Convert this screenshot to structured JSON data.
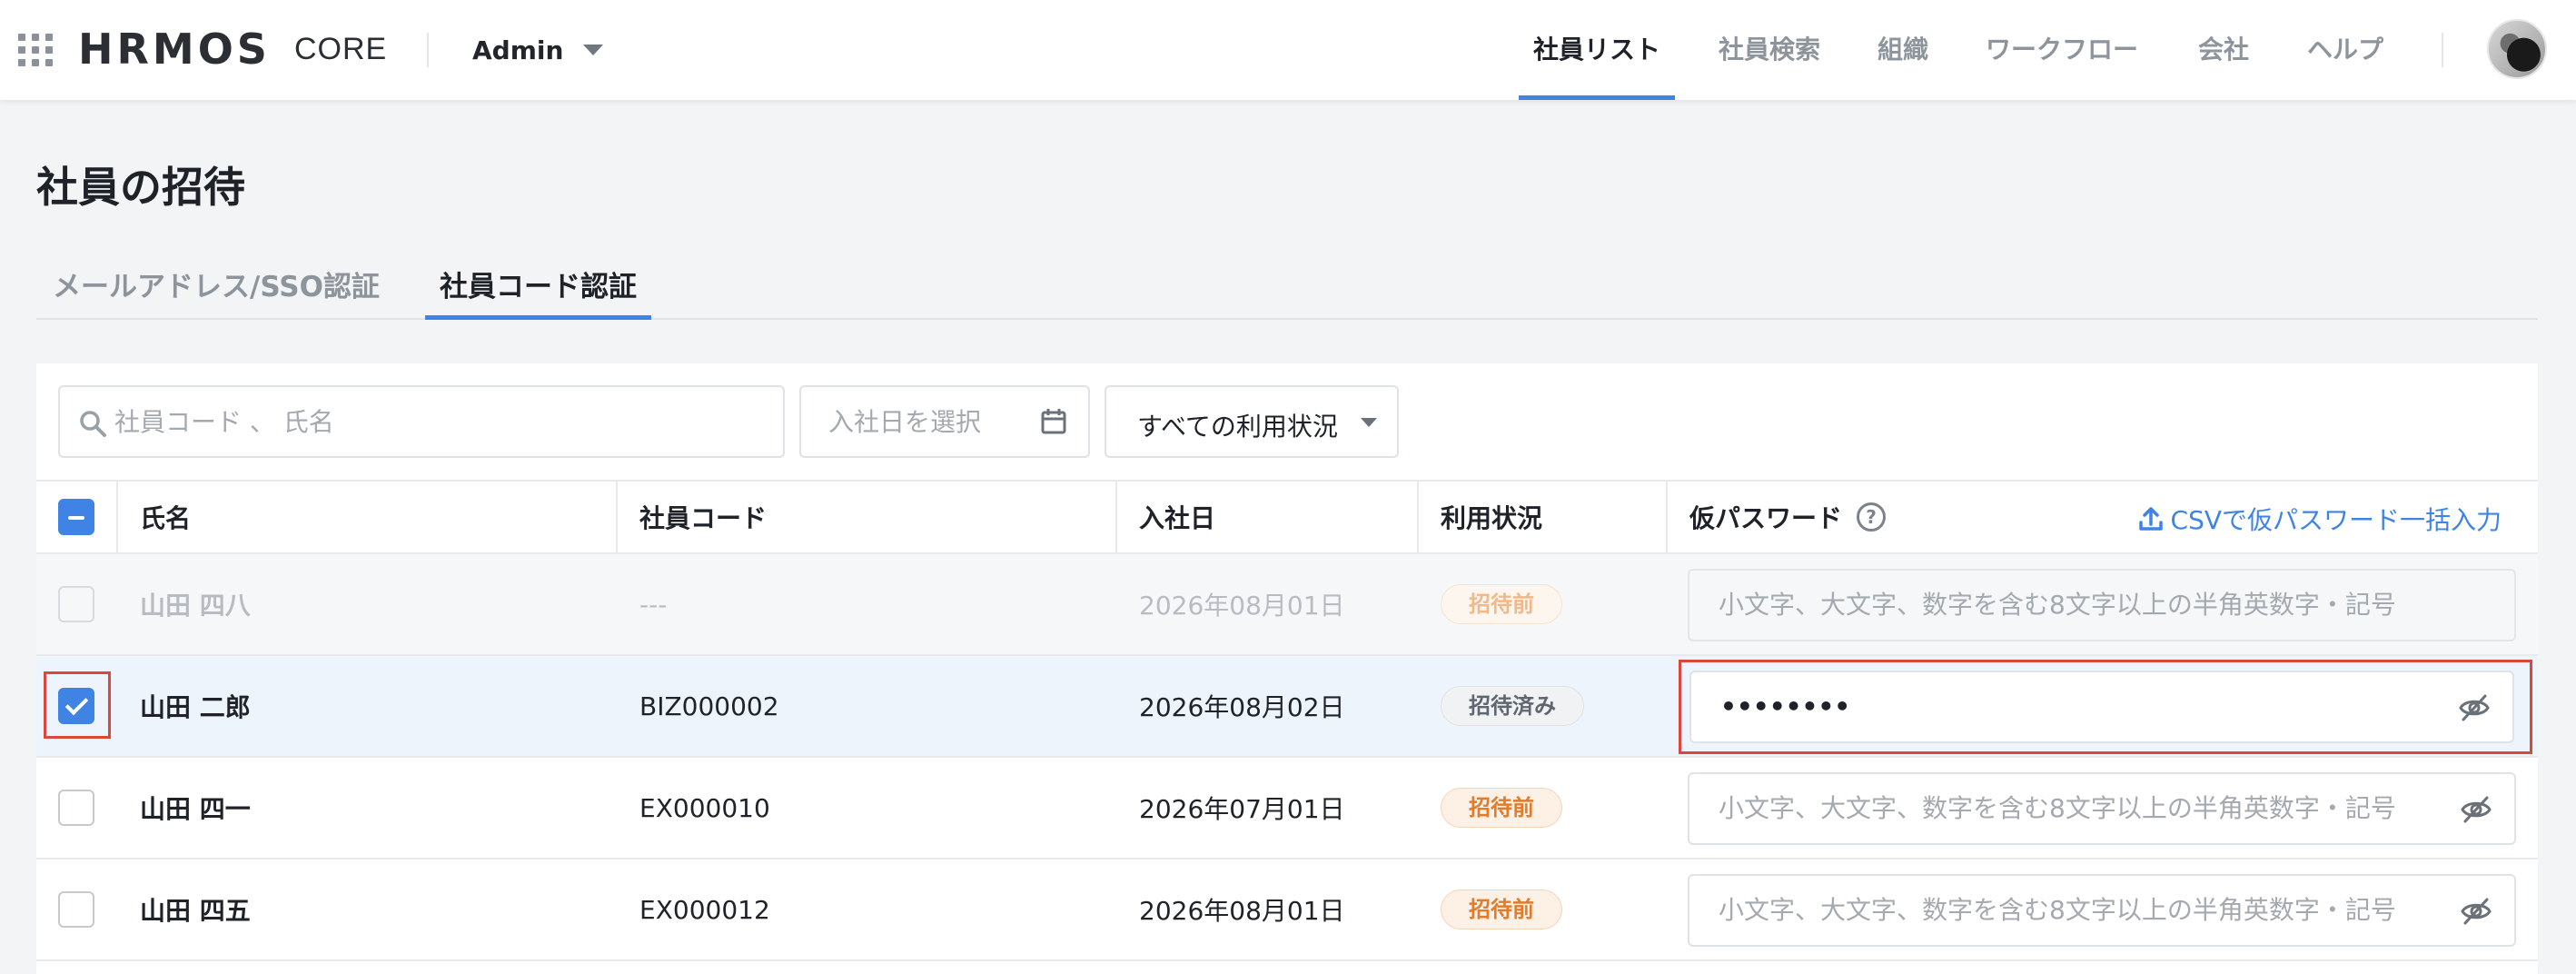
{
  "header": {
    "logo": "HRMOS",
    "logo_sub": "CORE",
    "role": "Admin",
    "nav": [
      {
        "label": "社員リスト",
        "active": true
      },
      {
        "label": "社員検索",
        "active": false
      },
      {
        "label": "組織",
        "active": false
      },
      {
        "label": "ワークフロー",
        "active": false
      },
      {
        "label": "会社",
        "active": false
      },
      {
        "label": "ヘルプ",
        "active": false
      }
    ]
  },
  "page": {
    "title": "社員の招待",
    "tabs": [
      {
        "label": "メールアドレス/SSO認証",
        "active": false
      },
      {
        "label": "社員コード認証",
        "active": true
      }
    ]
  },
  "filters": {
    "search_placeholder": "社員コード 、 氏名",
    "date_placeholder": "入社日を選択",
    "status_value": "すべての利用状況"
  },
  "table": {
    "columns": {
      "name": "氏名",
      "code": "社員コード",
      "hire_date": "入社日",
      "status": "利用状況",
      "password": "仮パスワード"
    },
    "csv_link": "CSVで仮パスワード一括入力",
    "password_placeholder": "小文字、大文字、数字を含む8文字以上の半角英数字・記号",
    "rows": [
      {
        "name": "山田 四八",
        "code": "---",
        "hire_date": "2026年08月01日",
        "status": "招待前",
        "password": "",
        "state": "disabled",
        "checked": false
      },
      {
        "name": "山田 二郎",
        "code": "BIZ000002",
        "hire_date": "2026年08月02日",
        "status": "招待済み",
        "password": "••••••••",
        "state": "selected",
        "checked": true
      },
      {
        "name": "山田 四一",
        "code": "EX000010",
        "hire_date": "2026年07月01日",
        "status": "招待前",
        "password": "",
        "state": "normal",
        "checked": false
      },
      {
        "name": "山田 四五",
        "code": "EX000012",
        "hire_date": "2026年08月01日",
        "status": "招待前",
        "password": "",
        "state": "normal",
        "checked": false
      }
    ]
  },
  "colors": {
    "accent": "#3f84e5",
    "highlight": "#d9483b",
    "badge_before": "#e07c2c"
  },
  "icons": {
    "apps": "grid-icon",
    "search": "search-icon",
    "calendar": "calendar-icon",
    "help": "question-circle-icon",
    "upload": "upload-icon",
    "eye": "eye-slash-icon"
  }
}
